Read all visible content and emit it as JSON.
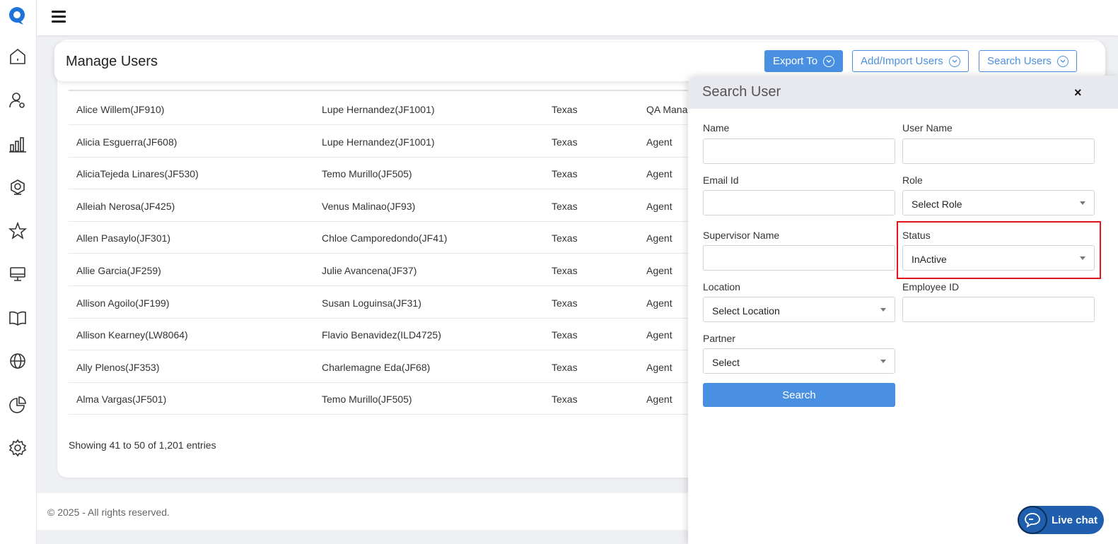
{
  "colors": {
    "accent": "#4a90e2",
    "highlight": "#e8141c",
    "chat": "#1f5fae"
  },
  "sidebar": {
    "icons": [
      "home-icon",
      "user-settings-icon",
      "bar-chart-icon",
      "webcam-icon",
      "star-icon",
      "monitor-icon",
      "book-icon",
      "globe-icon",
      "pie-chart-icon",
      "gear-icon"
    ]
  },
  "header": {
    "title": "Manage Users",
    "export_label": "Export To",
    "add_label": "Add/Import Users",
    "search_label": "Search Users"
  },
  "table": {
    "rows": [
      [
        "Alice Willem(JF910)",
        "Lupe Hernandez(JF1001)",
        "Texas",
        "QA Manager"
      ],
      [
        "Alicia Esguerra(JF608)",
        "Lupe Hernandez(JF1001)",
        "Texas",
        "Agent"
      ],
      [
        "AliciaTejeda Linares(JF530)",
        "Temo Murillo(JF505)",
        "Texas",
        "Agent"
      ],
      [
        "Alleiah Nerosa(JF425)",
        "Venus Malinao(JF93)",
        "Texas",
        "Agent"
      ],
      [
        "Allen Pasaylo(JF301)",
        "Chloe Camporedondo(JF41)",
        "Texas",
        "Agent"
      ],
      [
        "Allie Garcia(JF259)",
        "Julie Avancena(JF37)",
        "Texas",
        "Agent"
      ],
      [
        "Allison Agoilo(JF199)",
        "Susan Loguinsa(JF31)",
        "Texas",
        "Agent"
      ],
      [
        "Allison Kearney(LW8064)",
        "Flavio Benavidez(ILD4725)",
        "Texas",
        "Agent"
      ],
      [
        "Ally Plenos(JF353)",
        "Charlemagne Eda(JF68)",
        "Texas",
        "Agent"
      ],
      [
        "Alma Vargas(JF501)",
        "Temo Murillo(JF505)",
        "Texas",
        "Agent"
      ]
    ],
    "entries_text": "Showing 41 to 50 of 1,201 entries"
  },
  "footer": {
    "text": "© 2025 - All rights reserved."
  },
  "search_panel": {
    "title": "Search User",
    "close": "×",
    "name_label": "Name",
    "username_label": "User Name",
    "email_label": "Email Id",
    "role_label": "Role",
    "role_value": "Select Role",
    "supervisor_label": "Supervisor Name",
    "status_label": "Status",
    "status_value": "InActive",
    "location_label": "Location",
    "location_value": "Select Location",
    "employee_label": "Employee ID",
    "partner_label": "Partner",
    "partner_value": "Select",
    "search_button": "Search"
  },
  "livechat": {
    "label": "Live chat"
  }
}
